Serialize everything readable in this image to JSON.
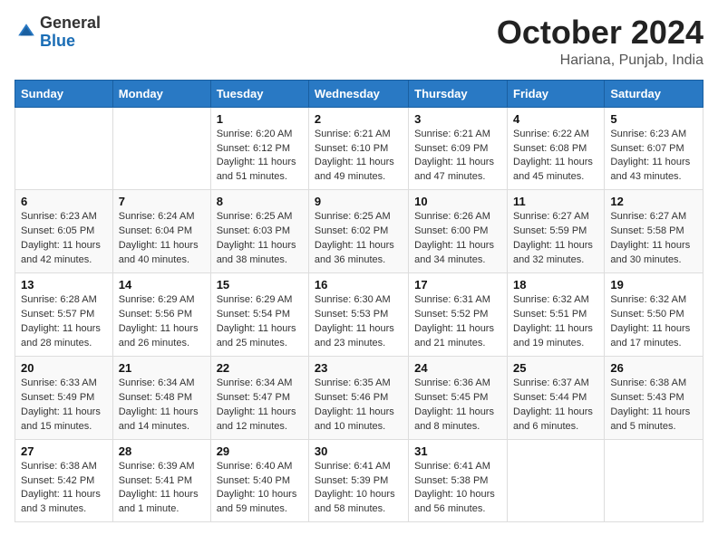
{
  "logo": {
    "general": "General",
    "blue": "Blue"
  },
  "header": {
    "month": "October 2024",
    "location": "Hariana, Punjab, India"
  },
  "weekdays": [
    "Sunday",
    "Monday",
    "Tuesday",
    "Wednesday",
    "Thursday",
    "Friday",
    "Saturday"
  ],
  "weeks": [
    [
      {
        "day": "",
        "sunrise": "",
        "sunset": "",
        "daylight": ""
      },
      {
        "day": "",
        "sunrise": "",
        "sunset": "",
        "daylight": ""
      },
      {
        "day": "1",
        "sunrise": "Sunrise: 6:20 AM",
        "sunset": "Sunset: 6:12 PM",
        "daylight": "Daylight: 11 hours and 51 minutes."
      },
      {
        "day": "2",
        "sunrise": "Sunrise: 6:21 AM",
        "sunset": "Sunset: 6:10 PM",
        "daylight": "Daylight: 11 hours and 49 minutes."
      },
      {
        "day": "3",
        "sunrise": "Sunrise: 6:21 AM",
        "sunset": "Sunset: 6:09 PM",
        "daylight": "Daylight: 11 hours and 47 minutes."
      },
      {
        "day": "4",
        "sunrise": "Sunrise: 6:22 AM",
        "sunset": "Sunset: 6:08 PM",
        "daylight": "Daylight: 11 hours and 45 minutes."
      },
      {
        "day": "5",
        "sunrise": "Sunrise: 6:23 AM",
        "sunset": "Sunset: 6:07 PM",
        "daylight": "Daylight: 11 hours and 43 minutes."
      }
    ],
    [
      {
        "day": "6",
        "sunrise": "Sunrise: 6:23 AM",
        "sunset": "Sunset: 6:05 PM",
        "daylight": "Daylight: 11 hours and 42 minutes."
      },
      {
        "day": "7",
        "sunrise": "Sunrise: 6:24 AM",
        "sunset": "Sunset: 6:04 PM",
        "daylight": "Daylight: 11 hours and 40 minutes."
      },
      {
        "day": "8",
        "sunrise": "Sunrise: 6:25 AM",
        "sunset": "Sunset: 6:03 PM",
        "daylight": "Daylight: 11 hours and 38 minutes."
      },
      {
        "day": "9",
        "sunrise": "Sunrise: 6:25 AM",
        "sunset": "Sunset: 6:02 PM",
        "daylight": "Daylight: 11 hours and 36 minutes."
      },
      {
        "day": "10",
        "sunrise": "Sunrise: 6:26 AM",
        "sunset": "Sunset: 6:00 PM",
        "daylight": "Daylight: 11 hours and 34 minutes."
      },
      {
        "day": "11",
        "sunrise": "Sunrise: 6:27 AM",
        "sunset": "Sunset: 5:59 PM",
        "daylight": "Daylight: 11 hours and 32 minutes."
      },
      {
        "day": "12",
        "sunrise": "Sunrise: 6:27 AM",
        "sunset": "Sunset: 5:58 PM",
        "daylight": "Daylight: 11 hours and 30 minutes."
      }
    ],
    [
      {
        "day": "13",
        "sunrise": "Sunrise: 6:28 AM",
        "sunset": "Sunset: 5:57 PM",
        "daylight": "Daylight: 11 hours and 28 minutes."
      },
      {
        "day": "14",
        "sunrise": "Sunrise: 6:29 AM",
        "sunset": "Sunset: 5:56 PM",
        "daylight": "Daylight: 11 hours and 26 minutes."
      },
      {
        "day": "15",
        "sunrise": "Sunrise: 6:29 AM",
        "sunset": "Sunset: 5:54 PM",
        "daylight": "Daylight: 11 hours and 25 minutes."
      },
      {
        "day": "16",
        "sunrise": "Sunrise: 6:30 AM",
        "sunset": "Sunset: 5:53 PM",
        "daylight": "Daylight: 11 hours and 23 minutes."
      },
      {
        "day": "17",
        "sunrise": "Sunrise: 6:31 AM",
        "sunset": "Sunset: 5:52 PM",
        "daylight": "Daylight: 11 hours and 21 minutes."
      },
      {
        "day": "18",
        "sunrise": "Sunrise: 6:32 AM",
        "sunset": "Sunset: 5:51 PM",
        "daylight": "Daylight: 11 hours and 19 minutes."
      },
      {
        "day": "19",
        "sunrise": "Sunrise: 6:32 AM",
        "sunset": "Sunset: 5:50 PM",
        "daylight": "Daylight: 11 hours and 17 minutes."
      }
    ],
    [
      {
        "day": "20",
        "sunrise": "Sunrise: 6:33 AM",
        "sunset": "Sunset: 5:49 PM",
        "daylight": "Daylight: 11 hours and 15 minutes."
      },
      {
        "day": "21",
        "sunrise": "Sunrise: 6:34 AM",
        "sunset": "Sunset: 5:48 PM",
        "daylight": "Daylight: 11 hours and 14 minutes."
      },
      {
        "day": "22",
        "sunrise": "Sunrise: 6:34 AM",
        "sunset": "Sunset: 5:47 PM",
        "daylight": "Daylight: 11 hours and 12 minutes."
      },
      {
        "day": "23",
        "sunrise": "Sunrise: 6:35 AM",
        "sunset": "Sunset: 5:46 PM",
        "daylight": "Daylight: 11 hours and 10 minutes."
      },
      {
        "day": "24",
        "sunrise": "Sunrise: 6:36 AM",
        "sunset": "Sunset: 5:45 PM",
        "daylight": "Daylight: 11 hours and 8 minutes."
      },
      {
        "day": "25",
        "sunrise": "Sunrise: 6:37 AM",
        "sunset": "Sunset: 5:44 PM",
        "daylight": "Daylight: 11 hours and 6 minutes."
      },
      {
        "day": "26",
        "sunrise": "Sunrise: 6:38 AM",
        "sunset": "Sunset: 5:43 PM",
        "daylight": "Daylight: 11 hours and 5 minutes."
      }
    ],
    [
      {
        "day": "27",
        "sunrise": "Sunrise: 6:38 AM",
        "sunset": "Sunset: 5:42 PM",
        "daylight": "Daylight: 11 hours and 3 minutes."
      },
      {
        "day": "28",
        "sunrise": "Sunrise: 6:39 AM",
        "sunset": "Sunset: 5:41 PM",
        "daylight": "Daylight: 11 hours and 1 minute."
      },
      {
        "day": "29",
        "sunrise": "Sunrise: 6:40 AM",
        "sunset": "Sunset: 5:40 PM",
        "daylight": "Daylight: 10 hours and 59 minutes."
      },
      {
        "day": "30",
        "sunrise": "Sunrise: 6:41 AM",
        "sunset": "Sunset: 5:39 PM",
        "daylight": "Daylight: 10 hours and 58 minutes."
      },
      {
        "day": "31",
        "sunrise": "Sunrise: 6:41 AM",
        "sunset": "Sunset: 5:38 PM",
        "daylight": "Daylight: 10 hours and 56 minutes."
      },
      {
        "day": "",
        "sunrise": "",
        "sunset": "",
        "daylight": ""
      },
      {
        "day": "",
        "sunrise": "",
        "sunset": "",
        "daylight": ""
      }
    ]
  ]
}
